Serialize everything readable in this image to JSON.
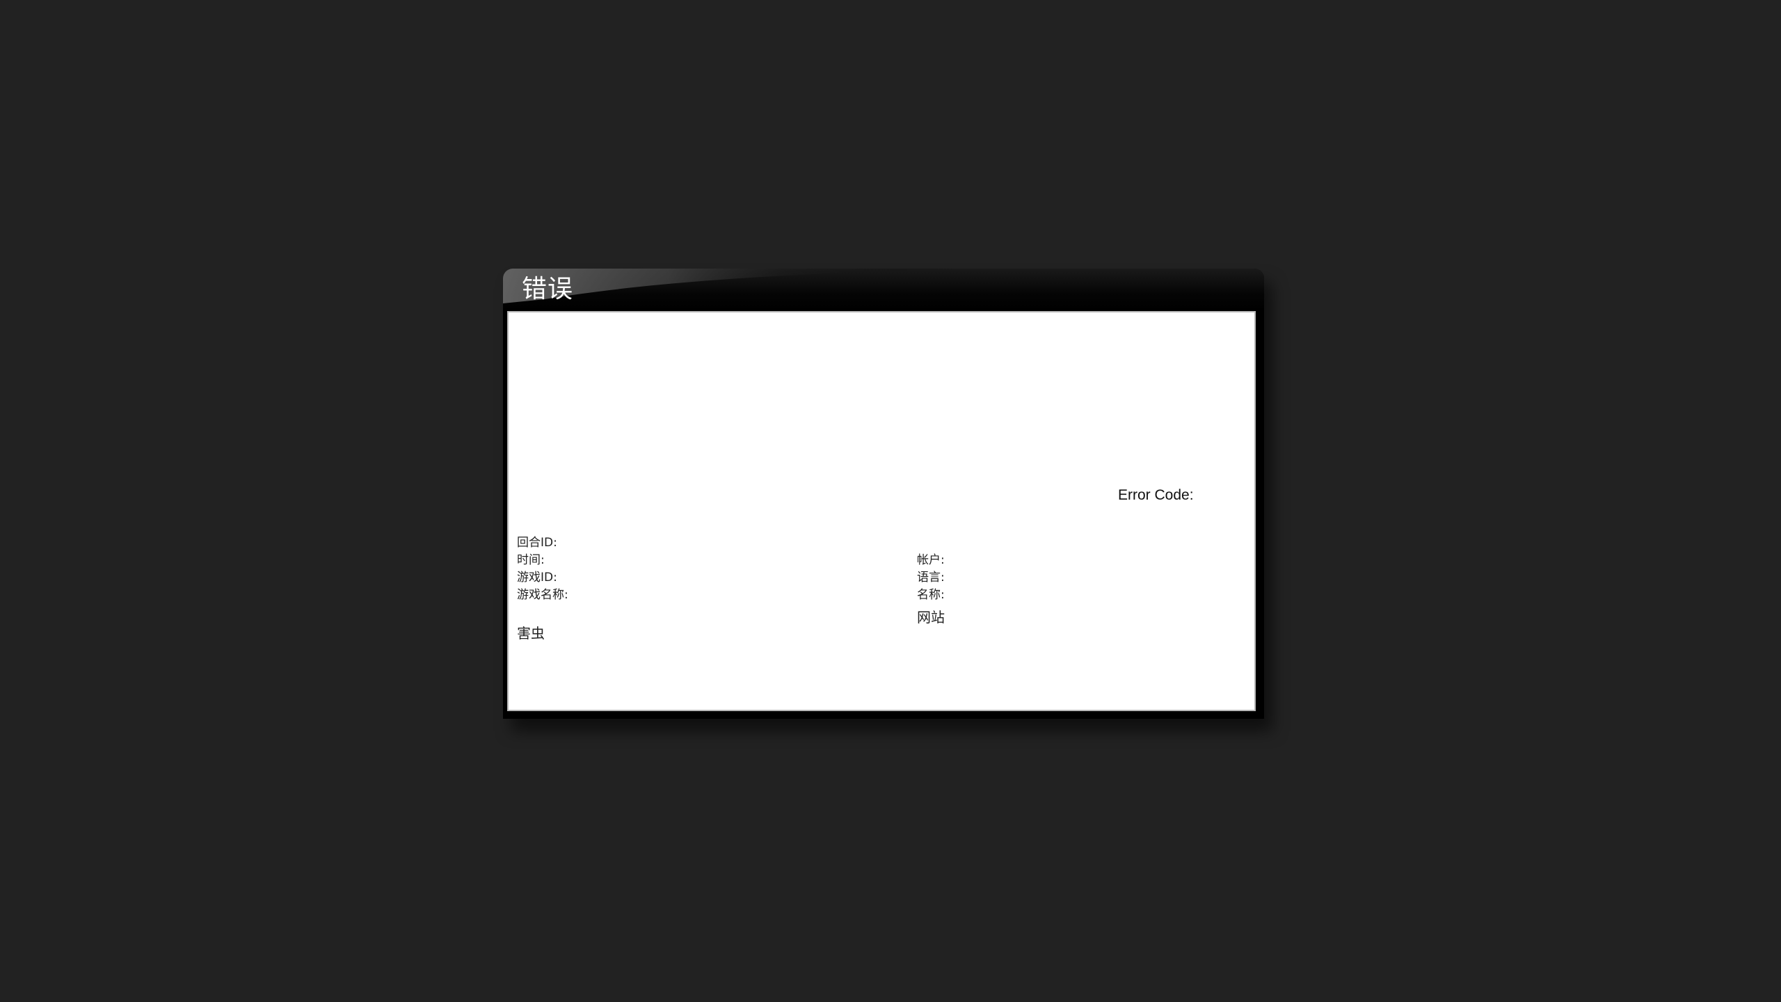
{
  "dialog": {
    "title": "错误",
    "error_code_label": "Error Code:",
    "left_fields": {
      "round_id": "回合ID:",
      "time": "时间:",
      "game_id": "游戏ID:",
      "game_name": "游戏名称:"
    },
    "right_fields": {
      "account": "帐户:",
      "language": "语言:",
      "name": "名称:"
    },
    "website": "网站",
    "pest": "害虫"
  },
  "colors": {
    "background": "#222222",
    "titlebar": "#000000",
    "content": "#ffffff"
  }
}
